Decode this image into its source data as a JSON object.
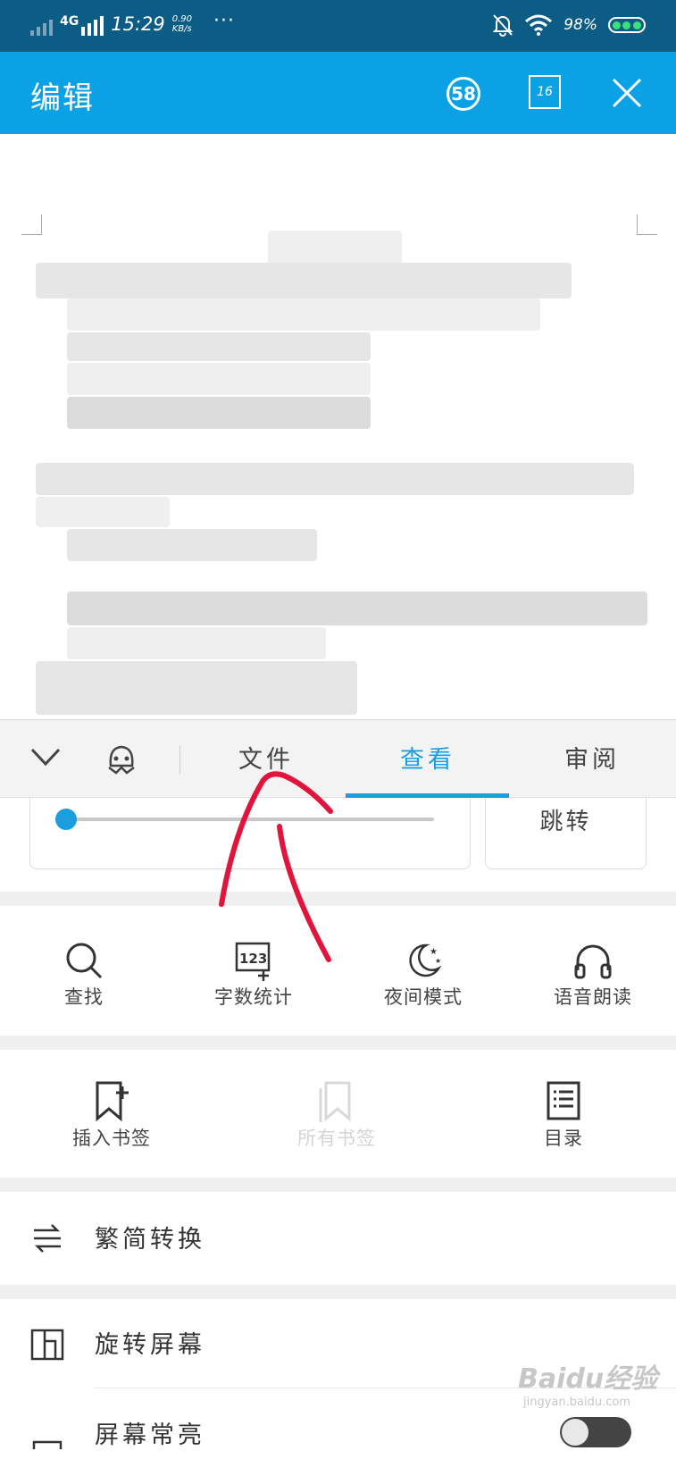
{
  "status_bar": {
    "network": "4G",
    "time": "15:29",
    "speed_value": "0.90",
    "speed_unit": "KB/s",
    "more": "···",
    "battery_percent": "98%"
  },
  "header": {
    "title": "编辑",
    "count_badge": "58",
    "page_badge": "16"
  },
  "tabs": [
    {
      "label": "文件",
      "active": false
    },
    {
      "label": "查看",
      "active": true
    },
    {
      "label": "审阅",
      "active": false
    }
  ],
  "slider": {
    "position_fraction": 0.0,
    "jump_label": "跳转"
  },
  "tools": [
    {
      "label": "查找",
      "icon": "search-icon"
    },
    {
      "label": "字数统计",
      "icon": "word-count-icon"
    },
    {
      "label": "夜间模式",
      "icon": "night-mode-icon"
    },
    {
      "label": "语音朗读",
      "icon": "headphones-icon"
    }
  ],
  "bookmarks": [
    {
      "label": "插入书签",
      "icon": "insert-bookmark-icon",
      "enabled": true
    },
    {
      "label": "所有书签",
      "icon": "bookmark-list-icon",
      "enabled": false
    },
    {
      "label": "目录",
      "icon": "table-of-contents-icon",
      "enabled": true
    }
  ],
  "list_rows": [
    {
      "label": "繁简转换",
      "icon": "convert-icon"
    },
    {
      "label": "旋转屏幕",
      "icon": "rotate-screen-icon"
    },
    {
      "label": "屏幕常亮",
      "icon": "screen-on-icon",
      "toggle_on": false
    }
  ],
  "watermark": {
    "main": "Baidu经验",
    "sub": "jingyan.baidu.com"
  },
  "colors": {
    "status_bar": "#0d5c86",
    "title_bar": "#0aa2e4",
    "accent": "#1a9edd",
    "annotation": "#e0143c"
  }
}
